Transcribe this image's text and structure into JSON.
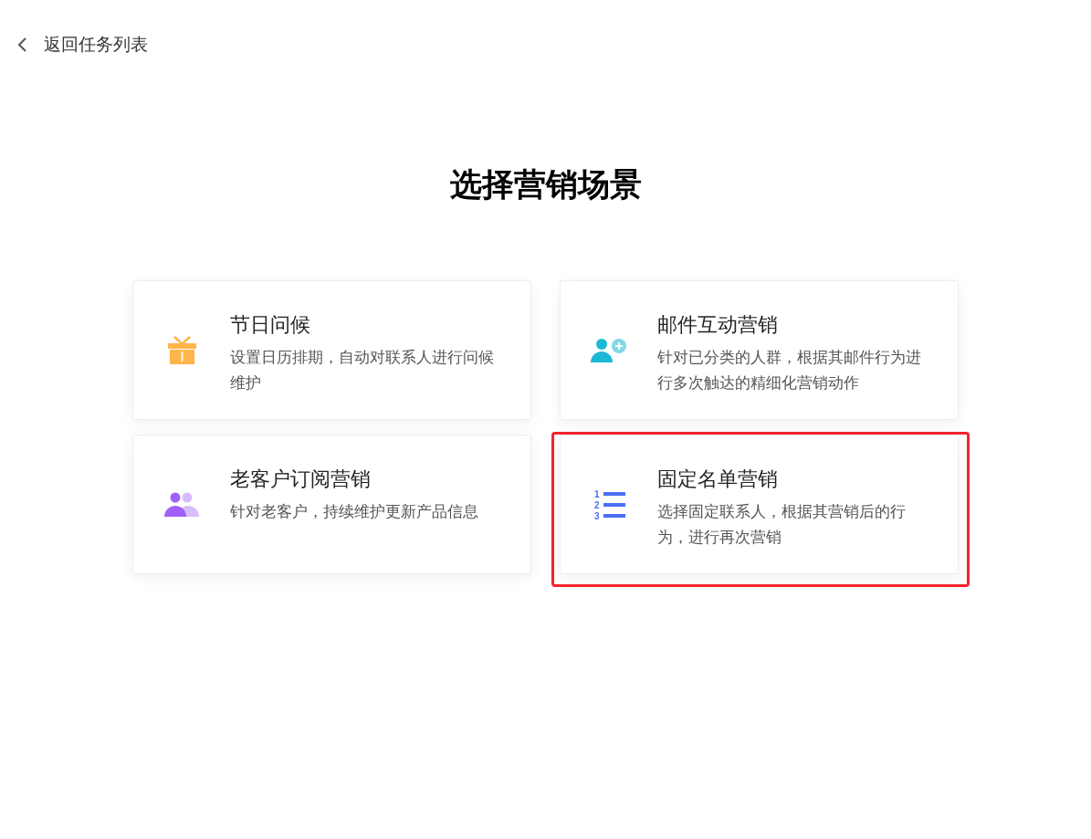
{
  "back_link": {
    "label": "返回任务列表"
  },
  "heading": "选择营销场景",
  "scenarios": [
    {
      "kind": "gift",
      "title": "节日问候",
      "description": "设置日历排期，自动对联系人进行问候维护",
      "highlighted": false
    },
    {
      "kind": "add-user",
      "title": "邮件互动营销",
      "description": "针对已分类的人群，根据其邮件行为进行多次触达的精细化营销动作",
      "highlighted": false
    },
    {
      "kind": "two-users",
      "title": "老客户订阅营销",
      "description": "针对老客户，持续维护更新产品信息",
      "highlighted": false
    },
    {
      "kind": "numbered-list",
      "icon_numbers": [
        "1",
        "2",
        "3"
      ],
      "title": "固定名单营销",
      "description": "选择固定联系人，根据其营销后的行为，进行再次营销",
      "highlighted": true
    }
  ]
}
